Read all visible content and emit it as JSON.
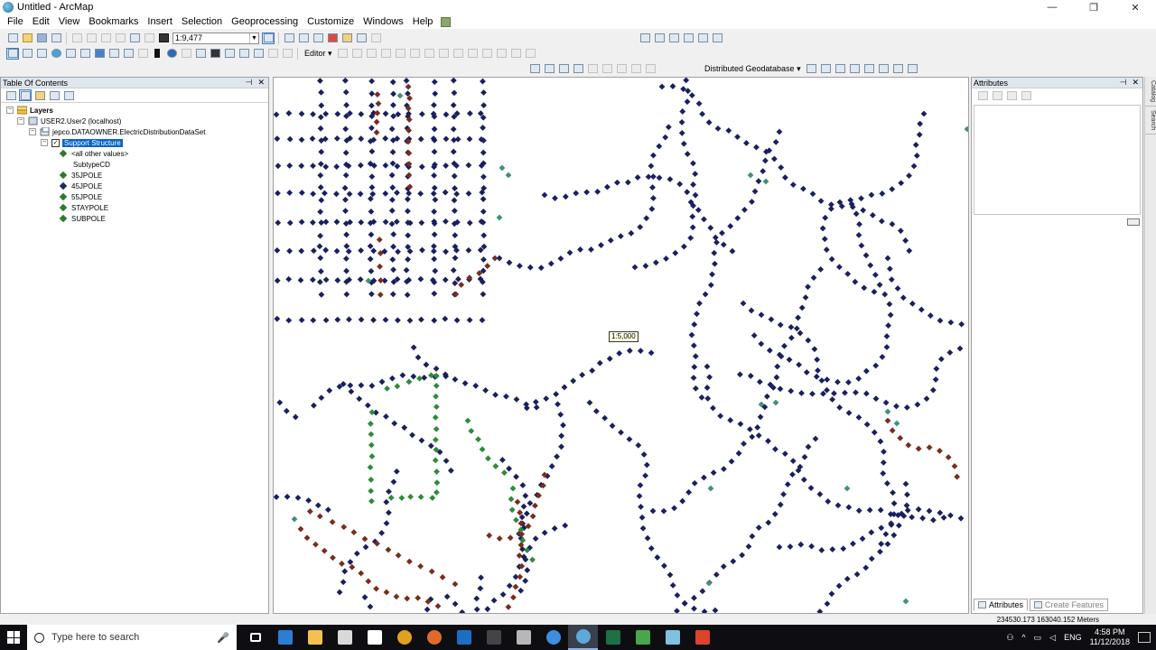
{
  "window": {
    "title": "Untitled - ArcMap",
    "controls": [
      "—",
      "❐",
      "✕"
    ]
  },
  "menu": [
    "File",
    "Edit",
    "View",
    "Bookmarks",
    "Insert",
    "Selection",
    "Geoprocessing",
    "Customize",
    "Windows",
    "Help"
  ],
  "toolbar": {
    "scale": "1:9,477",
    "editor_label": "Editor",
    "distributed_gdb_label": "Distributed Geodatabase"
  },
  "toc": {
    "title": "Table Of Contents",
    "tree": {
      "layers": "Layers",
      "connection": "USER2.User2 (localhost)",
      "dataset": "jepco.DATAOWNER.ElectricDistributionDataSet",
      "layer": "Support Structure",
      "legend_items": [
        {
          "label": "<all other values>",
          "color": "#2d7a2d"
        },
        {
          "label": "SubtypeCD",
          "color": ""
        },
        {
          "label": "35JPOLE",
          "color": "#2d7a2d"
        },
        {
          "label": "45JPOLE",
          "color": "#1e2a63"
        },
        {
          "label": "55JPOLE",
          "color": "#2d7a2d"
        },
        {
          "label": "STAYPOLE",
          "color": "#2d7a2d"
        },
        {
          "label": "SUBPOLE",
          "color": "#2d7a2d"
        }
      ]
    }
  },
  "map": {
    "scale_tip": "1:5,000",
    "symbol_colors": {
      "pole": "#1a1f5e",
      "stay": "#7a2c1c",
      "sub": "#2e8b3a",
      "teal": "#3f8f7f"
    }
  },
  "attributes": {
    "title": "Attributes",
    "tabs": [
      "Attributes",
      "Create Features"
    ]
  },
  "side_tabs": [
    "Catalog",
    "Search"
  ],
  "status": {
    "coordinates": "234530.173  163040.152 Meters"
  },
  "taskbar": {
    "search_placeholder": "Type here to search",
    "language": "ENG",
    "time": "4:58 PM",
    "date": "11/12/2018",
    "apps": [
      {
        "name": "task-view",
        "color": "#ffffff"
      },
      {
        "name": "edge",
        "color": "#2a7fd4"
      },
      {
        "name": "file-explorer",
        "color": "#f2c14e"
      },
      {
        "name": "store",
        "color": "#d9d9d9"
      },
      {
        "name": "mail",
        "color": "#ffffff"
      },
      {
        "name": "chrome",
        "color": "#e0a120"
      },
      {
        "name": "firefox",
        "color": "#e06a2c"
      },
      {
        "name": "outlook",
        "color": "#1b6ec2"
      },
      {
        "name": "terminal",
        "color": "#444444"
      },
      {
        "name": "tools",
        "color": "#b7b7b7"
      },
      {
        "name": "browser",
        "color": "#3d8ede"
      },
      {
        "name": "arcmap",
        "color": "#5fa9d8"
      },
      {
        "name": "excel",
        "color": "#1e7145"
      },
      {
        "name": "camtasia",
        "color": "#4aa64a"
      },
      {
        "name": "notes",
        "color": "#7fc1e0"
      },
      {
        "name": "recorder",
        "color": "#d9442c"
      }
    ]
  }
}
